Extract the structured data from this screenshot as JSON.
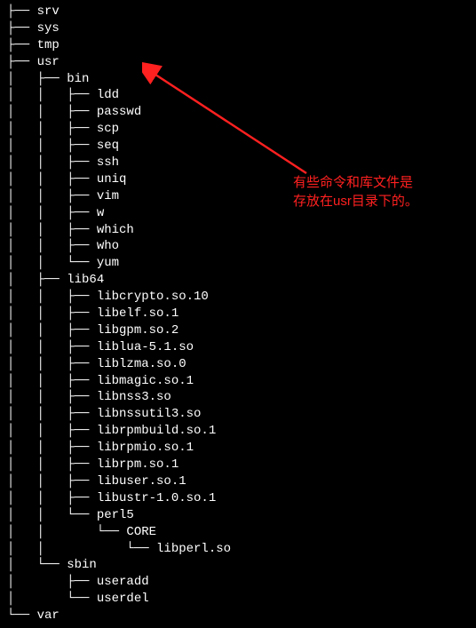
{
  "tree": {
    "top_entries": [
      {
        "prefix": "├── ",
        "name": "srv"
      },
      {
        "prefix": "├── ",
        "name": "sys"
      },
      {
        "prefix": "├── ",
        "name": "tmp"
      }
    ],
    "usr": {
      "prefix": "├── ",
      "name": "usr",
      "children": [
        {
          "prefix": "│   ├── ",
          "name": "bin",
          "children": [
            {
              "prefix": "│   │   ├── ",
              "name": "ldd"
            },
            {
              "prefix": "│   │   ├── ",
              "name": "passwd"
            },
            {
              "prefix": "│   │   ├── ",
              "name": "scp"
            },
            {
              "prefix": "│   │   ├── ",
              "name": "seq"
            },
            {
              "prefix": "│   │   ├── ",
              "name": "ssh"
            },
            {
              "prefix": "│   │   ├── ",
              "name": "uniq"
            },
            {
              "prefix": "│   │   ├── ",
              "name": "vim"
            },
            {
              "prefix": "│   │   ├── ",
              "name": "w"
            },
            {
              "prefix": "│   │   ├── ",
              "name": "which"
            },
            {
              "prefix": "│   │   ├── ",
              "name": "who"
            },
            {
              "prefix": "│   │   └── ",
              "name": "yum"
            }
          ]
        },
        {
          "prefix": "│   ├── ",
          "name": "lib64",
          "children": [
            {
              "prefix": "│   │   ├── ",
              "name": "libcrypto.so.10"
            },
            {
              "prefix": "│   │   ├── ",
              "name": "libelf.so.1"
            },
            {
              "prefix": "│   │   ├── ",
              "name": "libgpm.so.2"
            },
            {
              "prefix": "│   │   ├── ",
              "name": "liblua-5.1.so"
            },
            {
              "prefix": "│   │   ├── ",
              "name": "liblzma.so.0"
            },
            {
              "prefix": "│   │   ├── ",
              "name": "libmagic.so.1"
            },
            {
              "prefix": "│   │   ├── ",
              "name": "libnss3.so"
            },
            {
              "prefix": "│   │   ├── ",
              "name": "libnssutil3.so"
            },
            {
              "prefix": "│   │   ├── ",
              "name": "librpmbuild.so.1"
            },
            {
              "prefix": "│   │   ├── ",
              "name": "librpmio.so.1"
            },
            {
              "prefix": "│   │   ├── ",
              "name": "librpm.so.1"
            },
            {
              "prefix": "│   │   ├── ",
              "name": "libuser.so.1"
            },
            {
              "prefix": "│   │   ├── ",
              "name": "libustr-1.0.so.1"
            },
            {
              "prefix": "│   │   └── ",
              "name": "perl5",
              "children": [
                {
                  "prefix": "│   │       └── ",
                  "name": "CORE",
                  "children": [
                    {
                      "prefix": "│   │           └── ",
                      "name": "libperl.so"
                    }
                  ]
                }
              ]
            }
          ]
        },
        {
          "prefix": "│   └── ",
          "name": "sbin",
          "children": [
            {
              "prefix": "│       ├── ",
              "name": "useradd"
            },
            {
              "prefix": "│       └── ",
              "name": "userdel"
            }
          ]
        }
      ]
    },
    "var": {
      "prefix": "└── ",
      "name": "var"
    }
  },
  "annotation": {
    "line1": "有些命令和库文件是",
    "line2": "存放在usr目录下的。"
  },
  "colors": {
    "text": "#ffffff",
    "bg": "#000000",
    "annotation": "#ff2020"
  }
}
